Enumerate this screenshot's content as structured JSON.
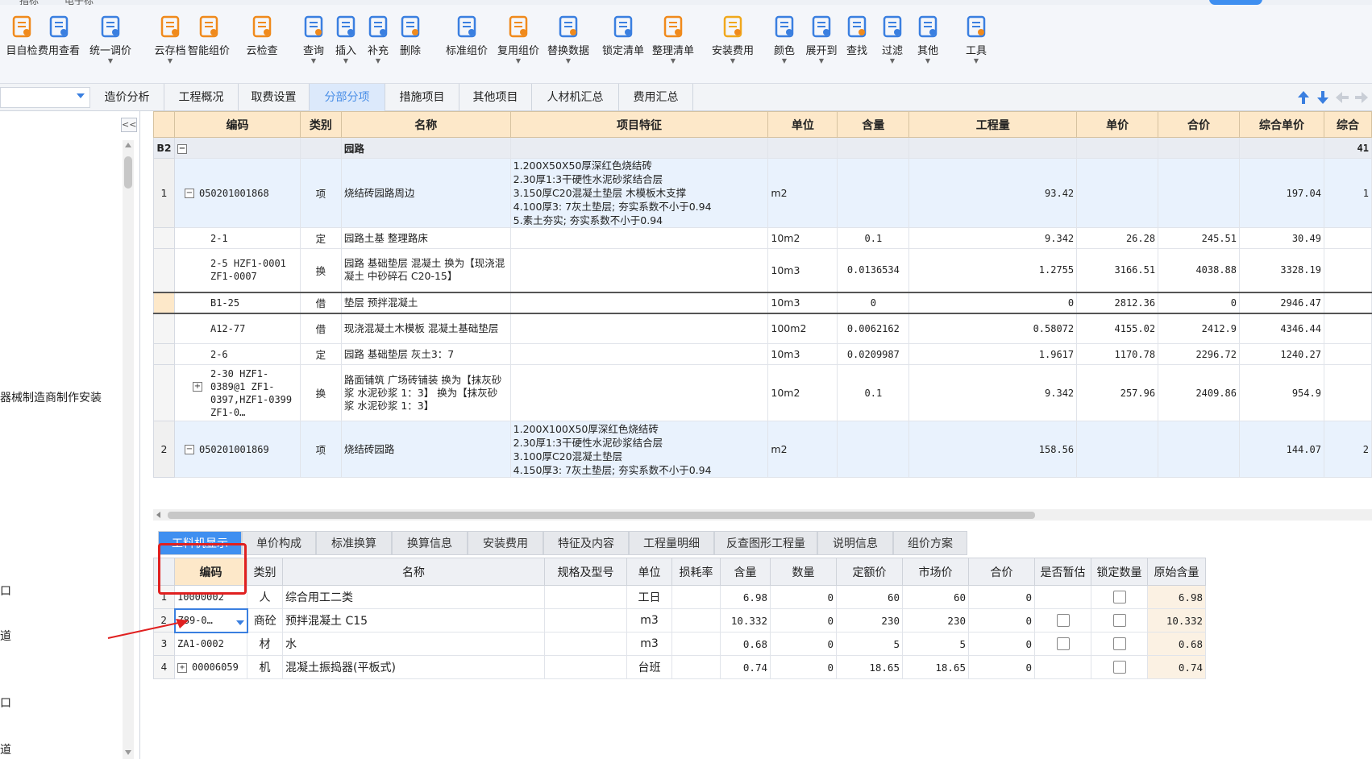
{
  "menu": {
    "item1": "指标",
    "item2": "电子标"
  },
  "toolbar": [
    {
      "label": "目自检",
      "icon": "self-check-icon",
      "caret": false
    },
    {
      "label": "费用查看",
      "icon": "cost-view-icon",
      "caret": false
    },
    {
      "label": "统一调价",
      "icon": "unified-price-icon",
      "caret": true
    },
    {
      "label": "云存档",
      "icon": "cloud-save-icon",
      "caret": true
    },
    {
      "label": "智能组价",
      "icon": "smart-pricing-icon",
      "caret": false
    },
    {
      "label": "云检查",
      "icon": "cloud-check-icon",
      "caret": false
    },
    {
      "label": "查询",
      "icon": "query-icon",
      "caret": true
    },
    {
      "label": "插入",
      "icon": "insert-icon",
      "caret": true
    },
    {
      "label": "补充",
      "icon": "supplement-icon",
      "caret": true
    },
    {
      "label": "删除",
      "icon": "delete-icon",
      "caret": false
    },
    {
      "label": "标准组价",
      "icon": "standard-pricing-icon",
      "caret": false
    },
    {
      "label": "复用组价",
      "icon": "reuse-pricing-icon",
      "caret": true
    },
    {
      "label": "替换数据",
      "icon": "replace-data-icon",
      "caret": true
    },
    {
      "label": "锁定清单",
      "icon": "lock-icon",
      "caret": false
    },
    {
      "label": "整理清单",
      "icon": "organize-list-icon",
      "caret": true
    },
    {
      "label": "安装费用",
      "icon": "install-cost-icon",
      "caret": true
    },
    {
      "label": "颜色",
      "icon": "color-icon",
      "caret": true
    },
    {
      "label": "展开到",
      "icon": "expand-to-icon",
      "caret": true
    },
    {
      "label": "查找",
      "icon": "find-icon",
      "caret": false
    },
    {
      "label": "过滤",
      "icon": "filter-icon",
      "caret": true
    },
    {
      "label": "其他",
      "icon": "other-icon",
      "caret": true
    },
    {
      "label": "工具",
      "icon": "tools-icon",
      "caret": true
    }
  ],
  "tabs": [
    "造价分析",
    "工程概况",
    "取费设置",
    "分部分项",
    "措施项目",
    "其他项目",
    "人材机汇总",
    "费用汇总"
  ],
  "active_tab": "分部分项",
  "left_panel": {
    "collapse": "<<",
    "items": [
      "器械制造商制作安装",
      "口",
      "道",
      "口",
      "道"
    ]
  },
  "main_table": {
    "headers": [
      "编码",
      "类别",
      "名称",
      "项目特征",
      "单位",
      "含量",
      "工程量",
      "单价",
      "合价",
      "综合单价",
      "综合"
    ],
    "section": {
      "rn": "B2",
      "name": "园路",
      "tail": "41"
    },
    "rows": [
      {
        "rn": "1",
        "code": "050201001868",
        "type": "项",
        "name": "烧结砖园路周边",
        "features": [
          "1.200X50X50厚深红色烧结砖",
          "2.30厚1:3干硬性水泥砂浆结合层",
          "3.150厚C20混凝土垫层 木模板木支撑",
          "4.100厚3: 7灰土垫层; 夯实系数不小于0.94",
          "5.素土夯实; 夯实系数不小于0.94"
        ],
        "unit": "m2",
        "content": "",
        "qty": "93.42",
        "price": "",
        "total": "",
        "uprice": "197.04",
        "tail": "1"
      },
      {
        "rn": "",
        "code": "2-1",
        "type": "定",
        "name": "园路土基 整理路床",
        "features": [],
        "unit": "10m2",
        "content": "0.1",
        "qty": "9.342",
        "price": "26.28",
        "total": "245.51",
        "uprice": "30.49",
        "tail": ""
      },
      {
        "rn": "",
        "code": "2-5 HZF1-0001 ZF1-0007",
        "type": "换",
        "name": "园路 基础垫层 混凝土  换为【现浇混凝土 中砂碎石 C20-15】",
        "features": [],
        "unit": "10m3",
        "content": "0.0136534",
        "qty": "1.2755",
        "price": "3166.51",
        "total": "4038.88",
        "uprice": "3328.19",
        "tail": ""
      },
      {
        "rn": "",
        "code": "B1-25",
        "type": "借",
        "name": "垫层 预拌混凝土",
        "features": [],
        "unit": "10m3",
        "content": "0",
        "qty": "0",
        "price": "2812.36",
        "total": "0",
        "uprice": "2946.47",
        "tail": ""
      },
      {
        "rn": "",
        "code": "A12-77",
        "type": "借",
        "name": "现浇混凝土木模板 混凝土基础垫层",
        "features": [],
        "unit": "100m2",
        "content": "0.0062162",
        "qty": "0.58072",
        "price": "4155.02",
        "total": "2412.9",
        "uprice": "4346.44",
        "tail": ""
      },
      {
        "rn": "",
        "code": "2-6",
        "type": "定",
        "name": "园路 基础垫层 灰土3：7",
        "features": [],
        "unit": "10m3",
        "content": "0.0209987",
        "qty": "1.9617",
        "price": "1170.78",
        "total": "2296.72",
        "uprice": "1240.27",
        "tail": ""
      },
      {
        "rn": "",
        "code": "2-30 HZF1-0389@1 ZF1-0397,HZF1-0399 ZF1-0…",
        "type": "换",
        "name": "路面铺筑 广场砖铺装  换为【抹灰砂浆 水泥砂浆 1：3】 换为【抹灰砂浆 水泥砂浆 1：3】",
        "features": [],
        "unit": "10m2",
        "content": "0.1",
        "qty": "9.342",
        "price": "257.96",
        "total": "2409.86",
        "uprice": "954.9",
        "tail": ""
      },
      {
        "rn": "2",
        "code": "050201001869",
        "type": "项",
        "name": "烧结砖园路",
        "features": [
          "1.200X100X50厚深红色烧结砖",
          "2.30厚1:3干硬性水泥砂浆结合层",
          "3.100厚C20混凝土垫层",
          "4.150厚3: 7灰土垫层; 夯实系数不小于0.94"
        ],
        "unit": "m2",
        "content": "",
        "qty": "158.56",
        "price": "",
        "total": "",
        "uprice": "144.07",
        "tail": "2"
      }
    ]
  },
  "bottom_tabs": [
    "工料机显示",
    "单价构成",
    "标准换算",
    "换算信息",
    "安装费用",
    "特征及内容",
    "工程量明细",
    "反查图形工程量",
    "说明信息",
    "组价方案"
  ],
  "active_bottom_tab": "工料机显示",
  "sub_table": {
    "headers": [
      "编码",
      "类别",
      "名称",
      "规格及型号",
      "单位",
      "损耗率",
      "含量",
      "数量",
      "定额价",
      "市场价",
      "合价",
      "是否暂估",
      "锁定数量",
      "原始含量"
    ],
    "rows": [
      {
        "rn": "1",
        "code": "10000002",
        "type": "人",
        "name": "综合用工二类",
        "spec": "",
        "unit": "工日",
        "loss": "",
        "content": "6.98",
        "amount": "0",
        "quota": "60",
        "market": "60",
        "total": "0",
        "est": false,
        "lock": true,
        "orig": "6.98"
      },
      {
        "rn": "2",
        "code": "Z89-0…",
        "type": "商砼",
        "name": "预拌混凝土 C15",
        "spec": "",
        "unit": "m3",
        "loss": "",
        "content": "10.332",
        "amount": "0",
        "quota": "230",
        "market": "230",
        "total": "0",
        "est": true,
        "lock": true,
        "orig": "10.332"
      },
      {
        "rn": "3",
        "code": "ZA1-0002",
        "type": "材",
        "name": "水",
        "spec": "",
        "unit": "m3",
        "loss": "",
        "content": "0.68",
        "amount": "0",
        "quota": "5",
        "market": "5",
        "total": "0",
        "est": true,
        "lock": true,
        "orig": "0.68"
      },
      {
        "rn": "4",
        "code": "00006059",
        "type": "机",
        "name": "混凝土振捣器(平板式)",
        "spec": "",
        "unit": "台班",
        "loss": "",
        "content": "0.74",
        "amount": "0",
        "quota": "18.65",
        "market": "18.65",
        "total": "0",
        "est": false,
        "lock": true,
        "orig": "0.74"
      }
    ]
  },
  "colors": {
    "accent": "#3f8ff0",
    "header_bg": "#fde8c9",
    "annotation": "#e02020"
  }
}
